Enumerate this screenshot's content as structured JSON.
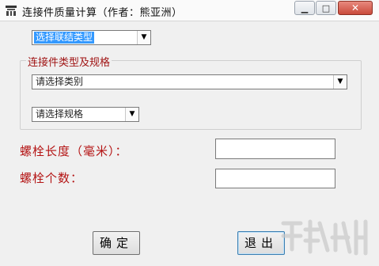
{
  "window": {
    "title": "连接件质量计算（作者：熊亚洲）",
    "icon": "app-icon",
    "controls": {
      "minimize": "minimize-icon",
      "maximize": "maximize-icon",
      "close": "close-icon"
    }
  },
  "connection_type": {
    "selected": "选择联结类型"
  },
  "group": {
    "title": "连接件类型及规格",
    "category": {
      "selected": "请选择类别"
    },
    "spec": {
      "selected": "请选择规格"
    }
  },
  "bolt_length": {
    "label": "螺栓长度（毫米）：",
    "value": ""
  },
  "bolt_count": {
    "label": "螺栓个数：",
    "value": ""
  },
  "buttons": {
    "confirm": "确定",
    "exit": "退出"
  },
  "colors": {
    "label_red": "#b41414",
    "selection_blue": "#3399ff"
  }
}
